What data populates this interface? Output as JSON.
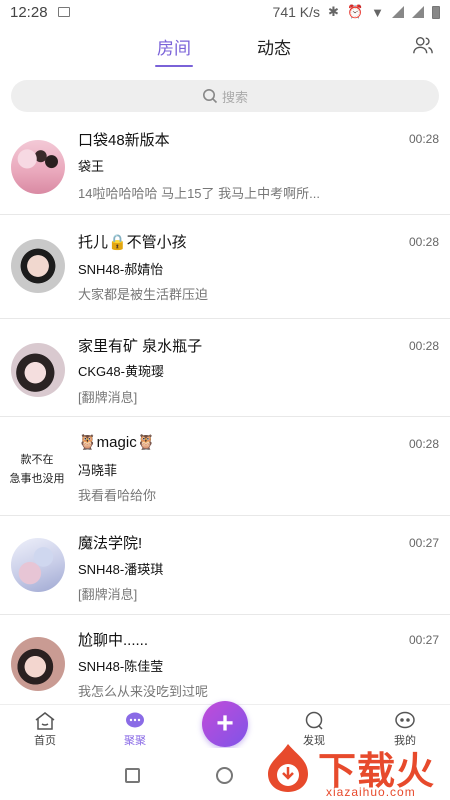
{
  "status_bar": {
    "time": "12:28",
    "speed": "741 K/s"
  },
  "header": {
    "tabs": [
      {
        "label": "房间",
        "active": true
      },
      {
        "label": "动态",
        "active": false
      }
    ]
  },
  "search": {
    "placeholder": "搜索"
  },
  "rooms": [
    {
      "name": "口袋48新版本",
      "sender": "袋王",
      "message": "14啦哈哈哈哈 马上15了 我马上中考啊所...",
      "time": "00:28"
    },
    {
      "name": "托儿🔒不管小孩",
      "sender": "SNH48-郝婧怡",
      "message": "大家都是被生活群压迫",
      "time": "00:28"
    },
    {
      "name": "家里有矿 泉水瓶子",
      "sender": "CKG48-黄琬璎",
      "message": "[翻牌消息]",
      "time": "00:28"
    },
    {
      "name": "🦉magic🦉",
      "sender": "冯晓菲",
      "message": "我看看哈给你",
      "time": "00:28",
      "avatar_text": [
        "款不在",
        "急事也没用"
      ]
    },
    {
      "name": "魔法学院!",
      "sender": "SNH48-潘瑛琪",
      "message": "[翻牌消息]",
      "time": "00:27"
    },
    {
      "name": "尬聊中......",
      "sender": "SNH48-陈佳莹",
      "message": "我怎么从来没吃到过呢",
      "time": "00:27"
    }
  ],
  "bottom_nav": {
    "home": "首页",
    "juju": "聚聚",
    "discover": "发现",
    "mine": "我的",
    "fab": "+"
  },
  "watermark": {
    "text": "下载火",
    "url": "xiazaihuo.com"
  },
  "colors": {
    "accent": "#7a62d8",
    "fab_start": "#c24bd9",
    "fab_end": "#7f54e8",
    "watermark": "#e74a2c"
  }
}
